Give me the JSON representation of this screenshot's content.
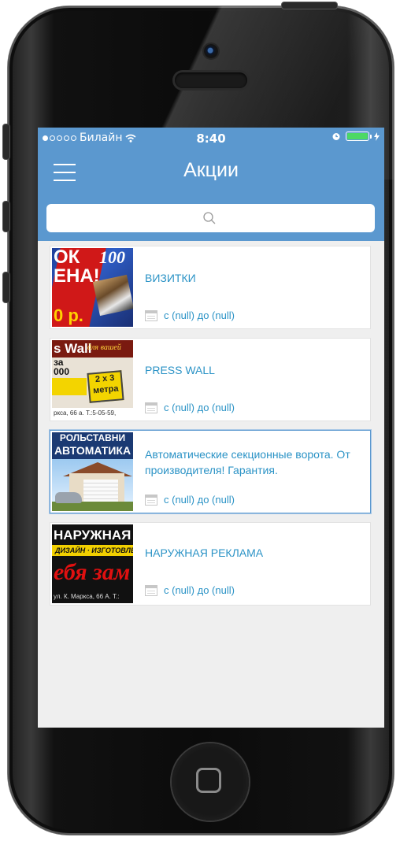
{
  "status_bar": {
    "carrier": "Билайн",
    "time": "8:40"
  },
  "header": {
    "title": "Акции",
    "search_placeholder": ""
  },
  "promotions": [
    {
      "title": "ВИЗИТКИ",
      "date_range": "с (null) до (null)",
      "thumb": {
        "line1": "ОК",
        "line2": "ЕНА!",
        "num": "100",
        "price": "0 р."
      }
    },
    {
      "title": "PRESS WALL",
      "date_range": "с (null) до (null)",
      "thumb": {
        "line1": "s Wall",
        "sub": "для вашей",
        "za": "за",
        "amount": "000",
        "size": "2 х 3 метра",
        "bottom": "ркса, 66 а. Т.:5-05-59,"
      }
    },
    {
      "title": "Автоматические секционные ворота. От производителя! Гарантия.",
      "date_range": "с (null) до (null)",
      "selected": true,
      "thumb": {
        "line1": "РОЛЬСТАВНИ",
        "line2": "АВТОМАТИКА"
      }
    },
    {
      "title": "НАРУЖНАЯ РЕКЛАМА",
      "date_range": "с (null) до (null)",
      "thumb": {
        "line1": "НАРУЖНАЯ Р",
        "line2": "ДИЗАЙН · ИЗГОТОВЛЕ",
        "line3": "ебя зам",
        "line4": "ул. К. Маркса, 66 А. Т.:"
      }
    }
  ],
  "colors": {
    "header_bg": "#5b98cf",
    "link": "#2b93c6",
    "list_bg": "#efefef",
    "battery": "#4cd964"
  }
}
